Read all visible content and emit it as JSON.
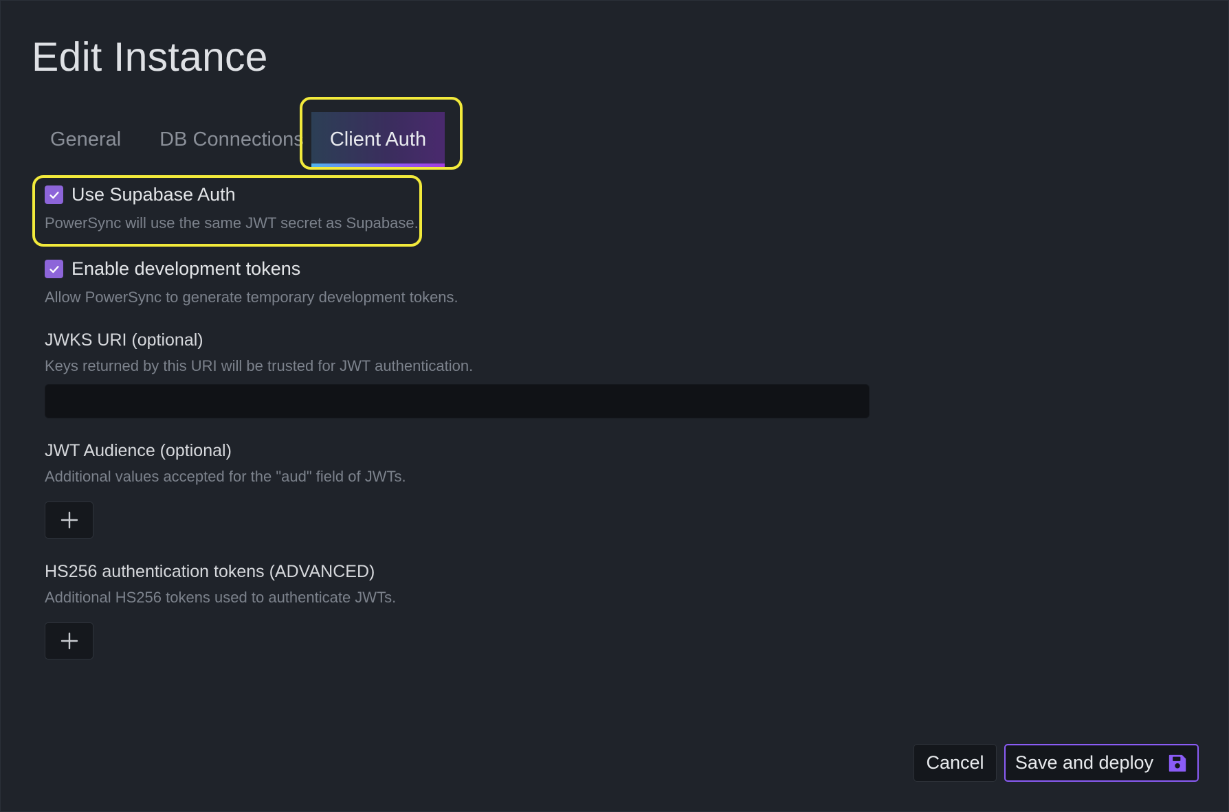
{
  "dialog": {
    "title": "Edit Instance"
  },
  "tabs": [
    {
      "label": "General",
      "active": false
    },
    {
      "label": "DB Connections",
      "active": false
    },
    {
      "label": "Client Auth",
      "active": true
    }
  ],
  "supabase_auth": {
    "label": "Use Supabase Auth",
    "checked": true,
    "hint": "PowerSync will use the same JWT secret as Supabase."
  },
  "dev_tokens": {
    "label": "Enable development tokens",
    "checked": true,
    "hint": "Allow PowerSync to generate temporary development tokens."
  },
  "jwks_uri": {
    "label": "JWKS URI (optional)",
    "hint": "Keys returned by this URI will be trusted for JWT authentication.",
    "value": "",
    "placeholder": ""
  },
  "jwt_audience": {
    "label": "JWT Audience (optional)",
    "hint": "Additional values accepted for the \"aud\" field of JWTs.",
    "add_icon": "plus-icon"
  },
  "hs256_tokens": {
    "label": "HS256 authentication tokens (ADVANCED)",
    "hint": "Additional HS256 tokens used to authenticate JWTs.",
    "add_icon": "plus-icon"
  },
  "footer": {
    "cancel_label": "Cancel",
    "save_label": "Save and deploy",
    "save_icon": "floppy-disk-icon"
  },
  "colors": {
    "background": "#1f232a",
    "accent": "#8b5cf6",
    "checkbox": "#8d65d9",
    "highlight": "#f2ea3b"
  }
}
